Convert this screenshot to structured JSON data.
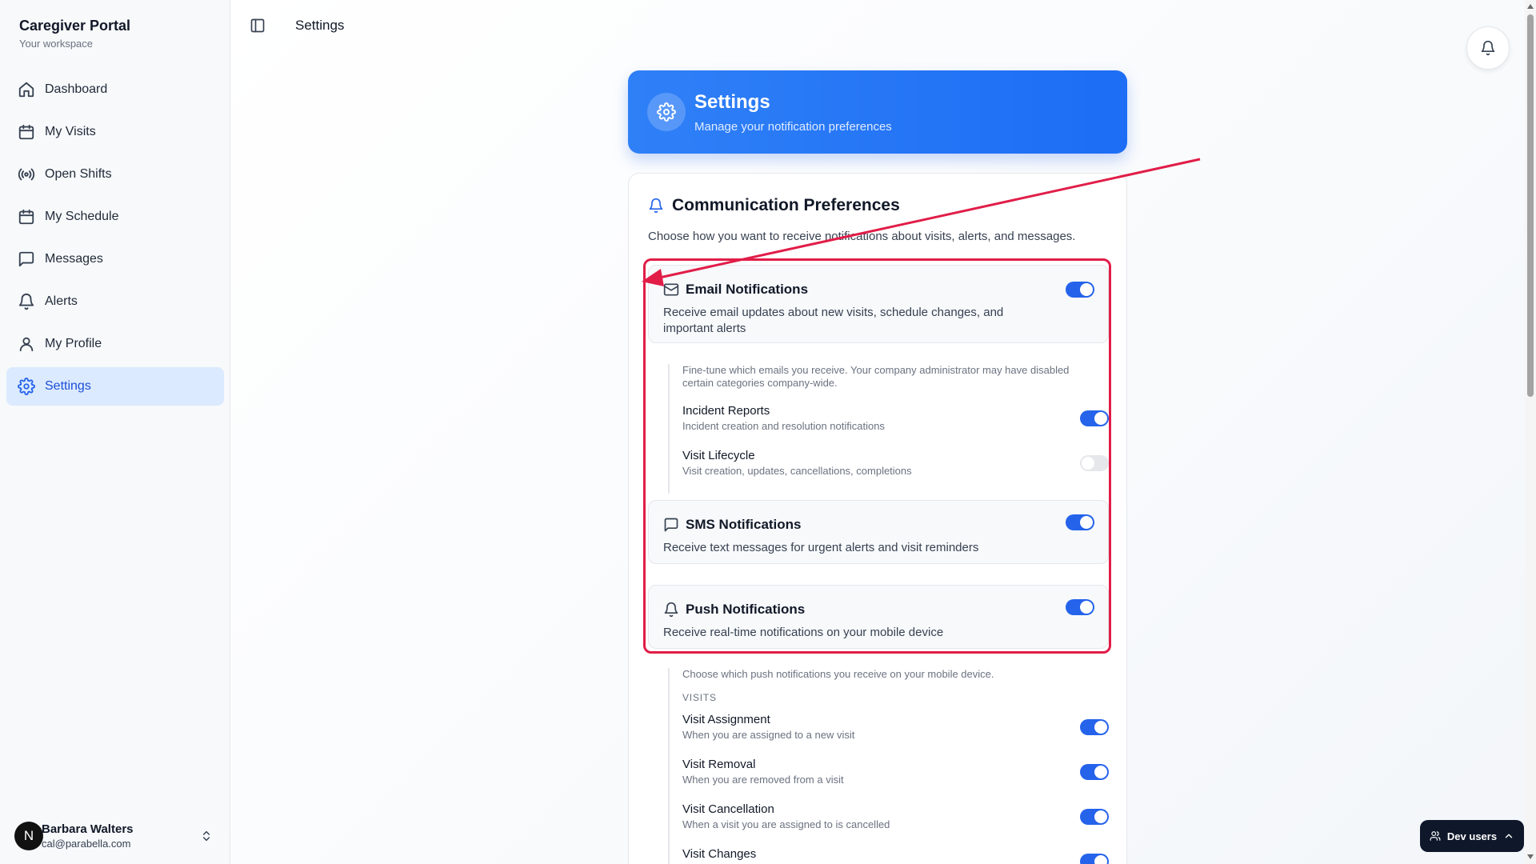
{
  "app": {
    "title": "Caregiver Portal",
    "subtitle": "Your workspace"
  },
  "sidebar": {
    "items": [
      {
        "label": "Dashboard",
        "icon": "home-icon"
      },
      {
        "label": "My Visits",
        "icon": "calendar-icon"
      },
      {
        "label": "Open Shifts",
        "icon": "broadcast-icon"
      },
      {
        "label": "My Schedule",
        "icon": "calendar-icon"
      },
      {
        "label": "Messages",
        "icon": "message-icon"
      },
      {
        "label": "Alerts",
        "icon": "bell-icon"
      },
      {
        "label": "My Profile",
        "icon": "user-icon"
      },
      {
        "label": "Settings",
        "icon": "gear-icon",
        "active": true
      }
    ]
  },
  "user": {
    "initial": "N",
    "name": "Barbara Walters",
    "email": "cal@parabella.com"
  },
  "topbar": {
    "title": "Settings"
  },
  "hero": {
    "title": "Settings",
    "subtitle": "Manage your notification preferences"
  },
  "preferences": {
    "title": "Communication Preferences",
    "description": "Choose how you want to receive notifications about visits, alerts, and messages.",
    "email": {
      "title": "Email Notifications",
      "description": "Receive email updates about new visits, schedule changes, and important alerts",
      "enabled": true,
      "note": "Fine-tune which emails you receive. Your company administrator may have disabled certain categories company-wide.",
      "items": [
        {
          "title": "Incident Reports",
          "description": "Incident creation and resolution notifications",
          "enabled": true
        },
        {
          "title": "Visit Lifecycle",
          "description": "Visit creation, updates, cancellations, completions",
          "enabled": false
        }
      ]
    },
    "sms": {
      "title": "SMS Notifications",
      "description": "Receive text messages for urgent alerts and visit reminders",
      "enabled": true
    },
    "push": {
      "title": "Push Notifications",
      "description": "Receive real-time notifications on your mobile device",
      "enabled": true,
      "note": "Choose which push notifications you receive on your mobile device.",
      "section": "VISITS",
      "items": [
        {
          "title": "Visit Assignment",
          "description": "When you are assigned to a new visit",
          "enabled": true
        },
        {
          "title": "Visit Removal",
          "description": "When you are removed from a visit",
          "enabled": true
        },
        {
          "title": "Visit Cancellation",
          "description": "When a visit you are assigned to is cancelled",
          "enabled": true
        },
        {
          "title": "Visit Changes",
          "description": "",
          "enabled": true
        }
      ]
    }
  },
  "dev": {
    "label": "Dev users"
  },
  "colors": {
    "accent": "#2563eb",
    "annotation": "#e11d48"
  }
}
